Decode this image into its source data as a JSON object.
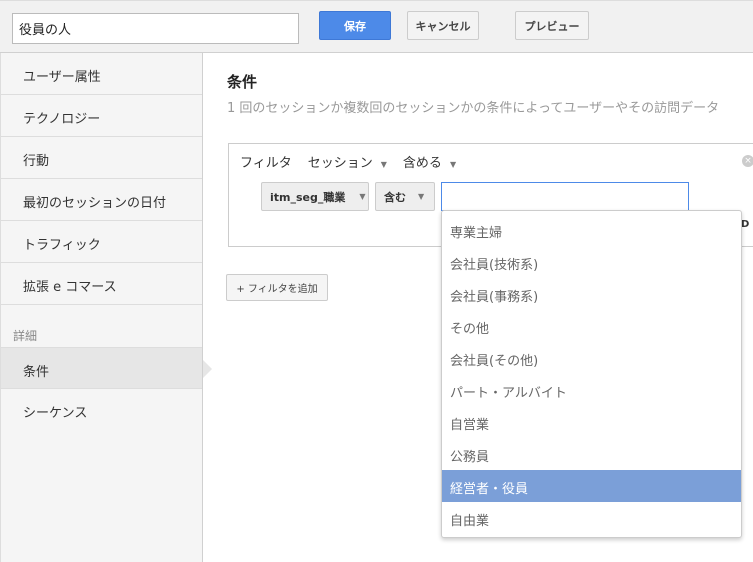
{
  "header": {
    "segment_name": "役員の人",
    "save": "保存",
    "cancel": "キャンセル",
    "preview": "プレビュー"
  },
  "sidebar": {
    "items": [
      "ユーザー属性",
      "テクノロジー",
      "行動",
      "最初のセッションの日付",
      "トラフィック",
      "拡張 e コマース"
    ],
    "section": "詳細",
    "detail_items": [
      "条件",
      "シーケンス"
    ],
    "selected": "条件"
  },
  "main": {
    "title": "条件",
    "description": "1 回のセッションか複数回のセッションかの条件によってユーザーやその訪問データ",
    "filter": {
      "label": "フィルタ",
      "scope": "セッション",
      "mode": "含める",
      "dimension": "itm_seg_職業",
      "operator": "含む",
      "value": "",
      "and_partial": "D"
    },
    "add_filter": "+ フィルタを追加"
  },
  "dropdown": {
    "options": [
      "専業主婦",
      "会社員(技術系)",
      "会社員(事務系)",
      "その他",
      "会社員(その他)",
      "パート・アルバイト",
      "自営業",
      "公務員",
      "経営者・役員",
      "自由業"
    ],
    "highlighted": "経営者・役員",
    "highlight_color": "#7b9fd8"
  },
  "colors": {
    "primary": "#4d8ae8"
  }
}
